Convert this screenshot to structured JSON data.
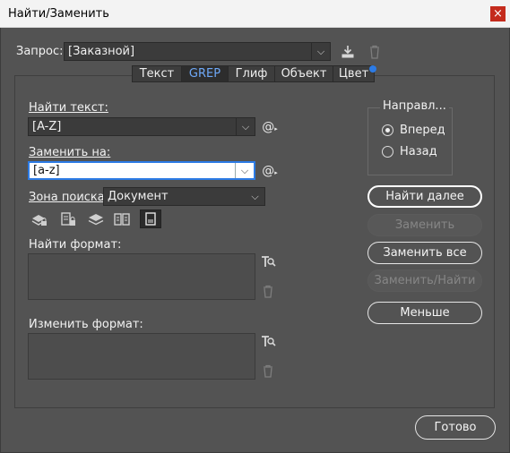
{
  "window": {
    "title": "Найти/Заменить",
    "close_glyph": "×"
  },
  "query": {
    "label": "Запрос:",
    "value": "[Заказной]"
  },
  "tabs": [
    {
      "label": "Текст",
      "selected": false
    },
    {
      "label": "GREP",
      "selected": true
    },
    {
      "label": "Глиф",
      "selected": false
    },
    {
      "label": "Объект",
      "selected": false
    },
    {
      "label": "Цвет",
      "selected": false
    }
  ],
  "find": {
    "label": "Найти текст:",
    "value": "[A-Z]"
  },
  "replace": {
    "label": "Заменить на:",
    "value": "[a-z]"
  },
  "search_scope": {
    "label": "Зона поиска:",
    "value": "Документ"
  },
  "find_format": {
    "label": "Найти формат:"
  },
  "change_format": {
    "label": "Изменить формат:"
  },
  "direction": {
    "title": "Направл...",
    "options": [
      "Вперед",
      "Назад"
    ],
    "selected": "Вперед"
  },
  "buttons": {
    "find_next": "Найти далее",
    "replace": "Заменить",
    "replace_all": "Заменить все",
    "replace_find": "Заменить/Найти",
    "less": "Меньше",
    "done": "Готово"
  },
  "icons": {
    "special_char": "@",
    "dropdown": "⌵",
    "save_query": "save-query-icon",
    "delete_query": "trash-icon",
    "format_settings": "format-settings-icon"
  },
  "colors": {
    "accent": "#2c7be5",
    "background": "#535353",
    "close": "#c42b1c"
  }
}
